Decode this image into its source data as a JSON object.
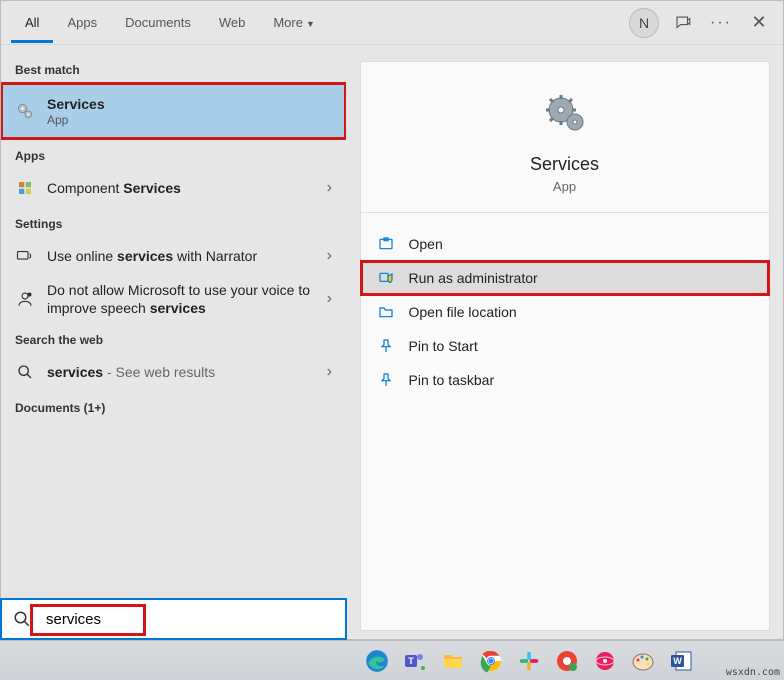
{
  "tabs": {
    "all": "All",
    "apps": "Apps",
    "documents": "Documents",
    "web": "Web",
    "more": "More"
  },
  "header": {
    "avatar_initial": "N"
  },
  "sections": {
    "best": "Best match",
    "apps": "Apps",
    "settings": "Settings",
    "web": "Search the web",
    "docs": "Documents (1+)"
  },
  "best": {
    "title": "Services",
    "subtitle": "App"
  },
  "apps_row": {
    "prefix": "Component ",
    "bold": "Services"
  },
  "settings1": {
    "p1": "Use online ",
    "b": "services",
    "p2": " with Narrator"
  },
  "settings2": {
    "p1": "Do not allow Microsoft to use your voice to improve speech ",
    "b": "services"
  },
  "web_row": {
    "bold": "services",
    "suffix": " - See web results"
  },
  "preview": {
    "title": "Services",
    "subtitle": "App"
  },
  "actions": {
    "open": "Open",
    "admin": "Run as administrator",
    "loc": "Open file location",
    "pin_start": "Pin to Start",
    "pin_tb": "Pin to taskbar"
  },
  "search_value": "services",
  "watermark": "wsxdn.com"
}
